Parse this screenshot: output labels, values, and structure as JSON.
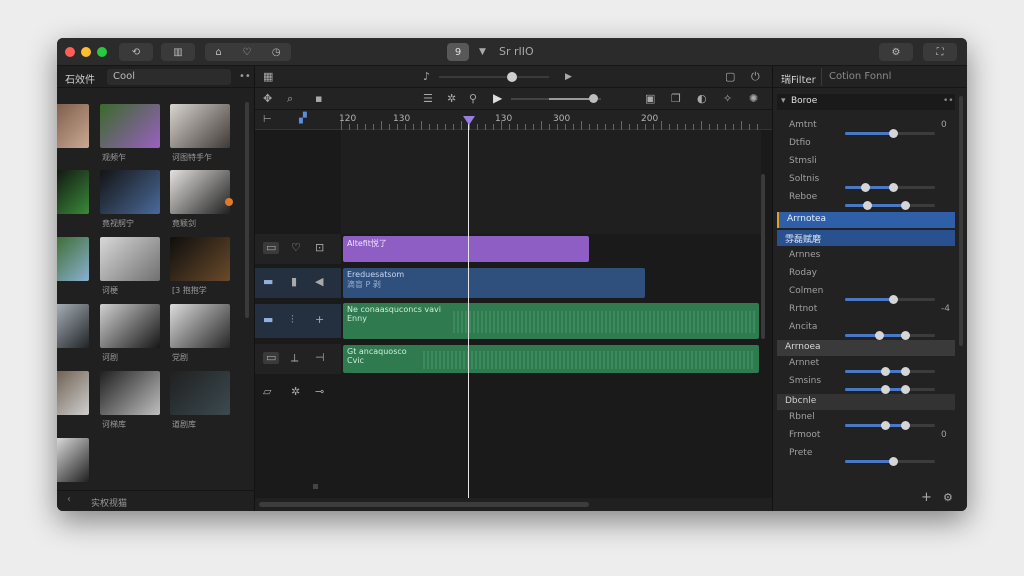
{
  "titlebar": {
    "title": "Sr rIIO",
    "doc_badge": "9",
    "tool_icons": [
      "history-icon",
      "library-icon",
      "home-icon",
      "shield-icon",
      "badge-icon"
    ],
    "right_icons": [
      "settings-icon",
      "share-icon"
    ]
  },
  "library": {
    "tab": "石效件",
    "search_value": "Cool",
    "menu": "••",
    "items": [
      {
        "label": "",
        "colors": [
          "#7a5a46",
          "#c9a894"
        ]
      },
      {
        "label": "观频乍",
        "colors": [
          "#3a6a2a",
          "#9a60c0"
        ]
      },
      {
        "label": "诃图特手乍",
        "colors": [
          "#d8d4d0",
          "#403a36"
        ]
      },
      {
        "label": "",
        "colors": [
          "#101010",
          "#3a8a3a"
        ]
      },
      {
        "label": "竟视舸宁",
        "colors": [
          "#141414",
          "#4a6a9a"
        ]
      },
      {
        "label": "竟颖剑",
        "colors": [
          "#e4e2e0",
          "#202020"
        ]
      },
      {
        "label": "",
        "colors": [
          "#3a6a2a",
          "#8ab0d0"
        ]
      },
      {
        "label": "诃梗",
        "colors": [
          "#d8d8d8",
          "#707070"
        ]
      },
      {
        "label": "[3 抱抱学",
        "colors": [
          "#0e0e0e",
          "#6a4a2a"
        ]
      },
      {
        "label": "",
        "colors": [
          "#b0b8c0",
          "#202428"
        ]
      },
      {
        "label": "诃剧",
        "colors": [
          "#d0d0d0",
          "#161616"
        ]
      },
      {
        "label": "党剧",
        "colors": [
          "#dcdcdc",
          "#262626"
        ]
      },
      {
        "label": "",
        "colors": [
          "#6a5a4a",
          "#cfcfcf"
        ]
      },
      {
        "label": "诃梯库",
        "colors": [
          "#202020",
          "#bfbfbf"
        ]
      },
      {
        "label": "道剧库",
        "colors": [
          "#202020",
          "#3c4a50"
        ]
      },
      {
        "label": "",
        "colors": [
          "#e6e6e6",
          "#202020"
        ]
      }
    ],
    "footer": "实权视猫"
  },
  "timeline": {
    "ruler_labels": [
      "120",
      "130",
      "130",
      "300",
      "200"
    ],
    "clips": {
      "purple": "Altefit悦了",
      "blue_1": "Ereduesatsom",
      "blue_2": "滴盲 P 剥",
      "green_1_a": "Ne conaasquconcs vavi",
      "green_1_b": "Enny",
      "green_2_a": "Gt ancaquosco",
      "green_2_b": "Cvic"
    }
  },
  "inspector": {
    "tabs": [
      "瑞Filter",
      "Cotion Fonnl"
    ],
    "section_title": "Boroe",
    "menu": "••",
    "rows": [
      {
        "label": "Amtnt",
        "value": "0"
      },
      {
        "label": "Dtfio",
        "value": ""
      },
      {
        "label": "Stmsli",
        "value": ""
      },
      {
        "label": "Soltnis",
        "value": ""
      },
      {
        "label": "Reboe",
        "value": ""
      }
    ],
    "highlight_1": "Arrnotea",
    "highlight_2": "雰磊赋磨",
    "rows2": [
      {
        "label": "Arnnes",
        "value": ""
      },
      {
        "label": "Roday",
        "value": ""
      },
      {
        "label": "Colmen",
        "value": ""
      },
      {
        "label": "Rrtnot",
        "value": "-4"
      },
      {
        "label": "Ancita",
        "value": ""
      }
    ],
    "section_2": "Arrnoea",
    "rows3": [
      {
        "label": "Arnnet",
        "value": ""
      },
      {
        "label": "Smsins",
        "value": ""
      }
    ],
    "section_3": "Dbcnle",
    "rows4": [
      {
        "label": "Rbnel",
        "value": ""
      },
      {
        "label": "Frmoot",
        "value": "0"
      },
      {
        "label": "Prete",
        "value": ""
      }
    ]
  }
}
